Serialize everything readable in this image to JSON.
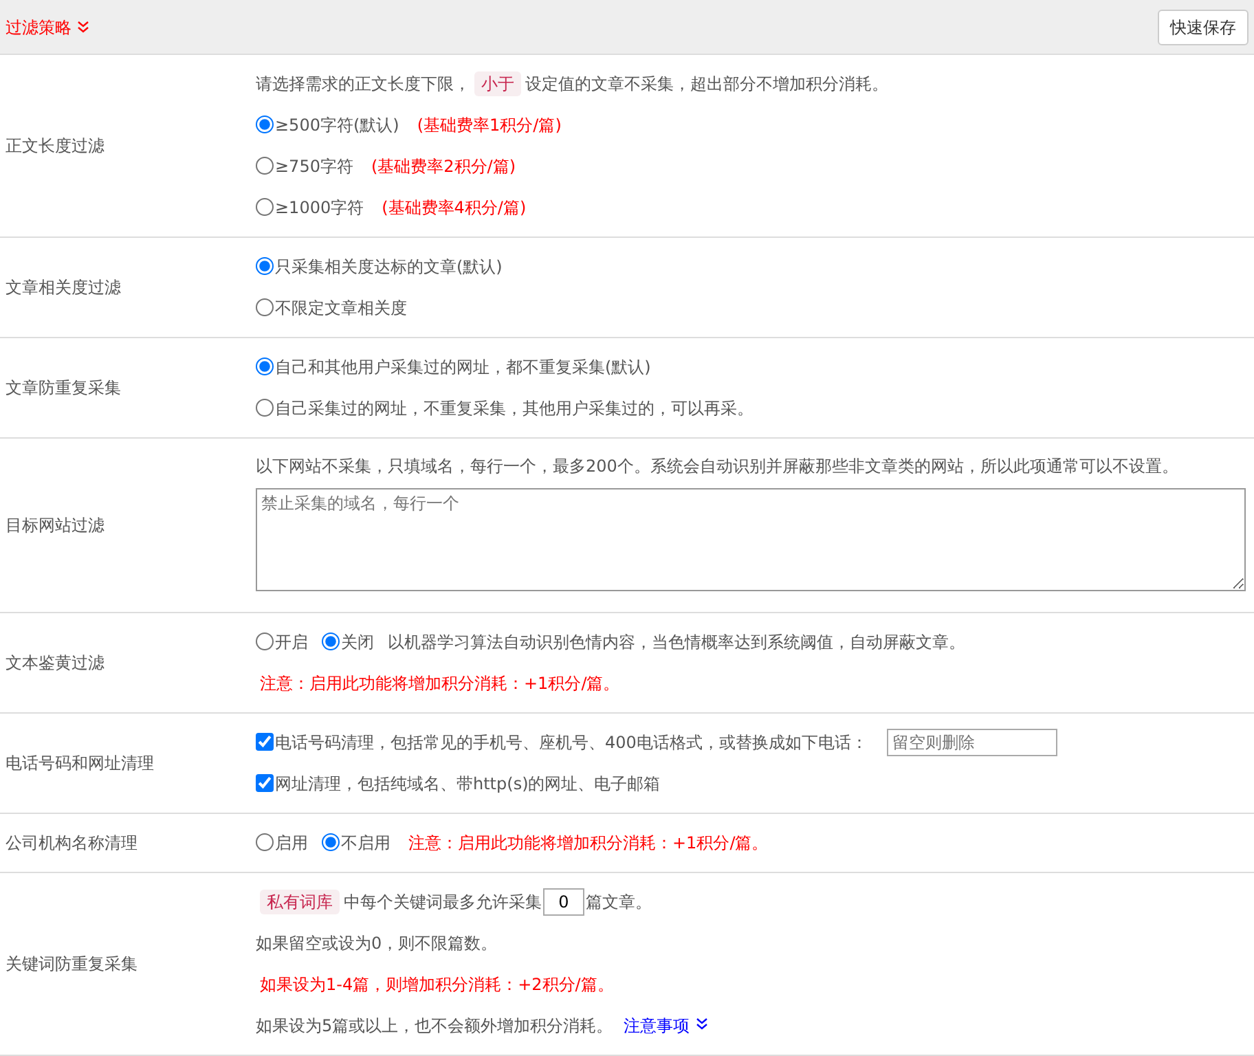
{
  "header": {
    "title": "过滤策略",
    "save_button": "快速保存"
  },
  "sections": [
    {
      "label": "正文长度过滤",
      "lines": [
        [
          {
            "kind": "text",
            "text": "请选择需求的正文长度下限，"
          },
          {
            "kind": "tag",
            "text": "小于"
          },
          {
            "kind": "text",
            "text": "设定值的文章不采集，超出部分不增加积分消耗。"
          }
        ],
        [
          {
            "kind": "radio",
            "label": "≥500字符(默认)",
            "selected": true
          },
          {
            "kind": "note",
            "text": "(基础费率1积分/篇)"
          }
        ],
        [
          {
            "kind": "radio",
            "label": "≥750字符",
            "selected": false
          },
          {
            "kind": "note",
            "text": "(基础费率2积分/篇)"
          }
        ],
        [
          {
            "kind": "radio",
            "label": "≥1000字符",
            "selected": false
          },
          {
            "kind": "note",
            "text": "(基础费率4积分/篇)"
          }
        ]
      ]
    },
    {
      "label": "文章相关度过滤",
      "lines": [
        [
          {
            "kind": "radio",
            "label": "只采集相关度达标的文章(默认)",
            "selected": true
          }
        ],
        [
          {
            "kind": "radio",
            "label": "不限定文章相关度",
            "selected": false
          }
        ]
      ]
    },
    {
      "label": "文章防重复采集",
      "lines": [
        [
          {
            "kind": "radio",
            "label": "自己和其他用户采集过的网址，都不重复采集(默认)",
            "selected": true
          }
        ],
        [
          {
            "kind": "radio",
            "label": "自己采集过的网址，不重复采集，其他用户采集过的，可以再采。",
            "selected": false
          }
        ]
      ]
    },
    {
      "label": "目标网站过滤",
      "lines": [
        [
          {
            "kind": "text",
            "text": "以下网站不采集，只填域名，每行一个，最多200个。系统会自动识别并屏蔽那些非文章类的网站，所以此项通常可以不设置。"
          }
        ],
        [
          {
            "kind": "textarea",
            "placeholder": "禁止采集的域名，每行一个"
          }
        ]
      ]
    },
    {
      "label": "文本鉴黄过滤",
      "lines": [
        [
          {
            "kind": "radio",
            "label": "开启",
            "selected": false
          },
          {
            "kind": "radio",
            "label": "关闭",
            "selected": true
          },
          {
            "kind": "text",
            "text": "以机器学习算法自动识别色情内容，当色情概率达到系统阈值，自动屏蔽文章。"
          }
        ],
        [
          {
            "kind": "note",
            "text": "注意：启用此功能将增加积分消耗：+1积分/篇。"
          }
        ]
      ]
    },
    {
      "label": "电话号码和网址清理",
      "lines": [
        [
          {
            "kind": "checkbox",
            "label": "电话号码清理，包括常见的手机号、座机号、400电话格式，或替换成如下电话：",
            "checked": true
          },
          {
            "kind": "input",
            "placeholder": "留空则删除"
          }
        ],
        [
          {
            "kind": "checkbox",
            "label": "网址清理，包括纯域名、带http(s)的网址、电子邮箱",
            "checked": true
          }
        ]
      ]
    },
    {
      "label": "公司机构名称清理",
      "lines": [
        [
          {
            "kind": "radio",
            "label": "启用",
            "selected": false
          },
          {
            "kind": "radio",
            "label": "不启用",
            "selected": true
          },
          {
            "kind": "note",
            "text": "注意：启用此功能将增加积分消耗：+1积分/篇。"
          }
        ]
      ]
    },
    {
      "label": "关键词防重复采集",
      "lines": [
        [
          {
            "kind": "tag",
            "text": "私有词库"
          },
          {
            "kind": "text",
            "text": "中每个关键词最多允许采集"
          },
          {
            "kind": "number",
            "value": "0"
          },
          {
            "kind": "text",
            "text": "篇文章。"
          }
        ],
        [
          {
            "kind": "text",
            "text": "如果留空或设为0，则不限篇数。"
          }
        ],
        [
          {
            "kind": "note",
            "text": "如果设为1-4篇，则增加积分消耗：+2积分/篇。"
          }
        ],
        [
          {
            "kind": "text",
            "text": "如果设为5篇或以上，也不会额外增加积分消耗。"
          },
          {
            "kind": "link",
            "text": "注意事项"
          }
        ]
      ]
    }
  ]
}
